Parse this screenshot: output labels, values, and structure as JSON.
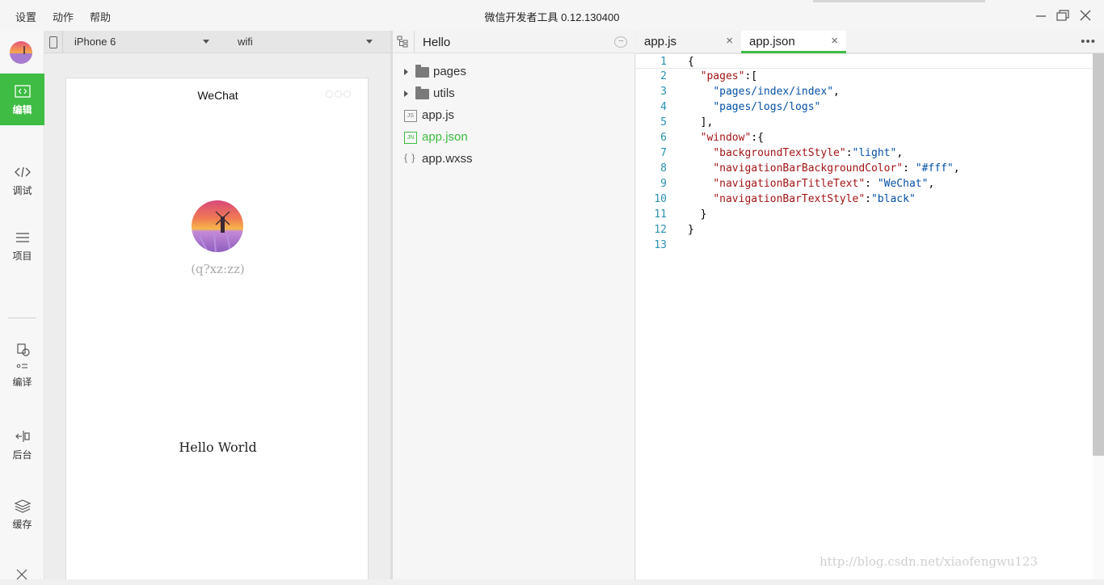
{
  "titlebar": {
    "menu": [
      "设置",
      "动作",
      "帮助"
    ],
    "title": "微信开发者工具 0.12.130400"
  },
  "leftnav": {
    "items": [
      {
        "label": "编辑",
        "icon": "code-icon",
        "active": true
      },
      {
        "label": "调试",
        "icon": "debug-icon"
      },
      {
        "label": "项目",
        "icon": "menu-icon"
      },
      {
        "label": "编译",
        "icon": "compile-icon"
      },
      {
        "label": "后台",
        "icon": "background-icon"
      },
      {
        "label": "缓存",
        "icon": "layers-icon"
      }
    ]
  },
  "simulator": {
    "device": "iPhone 6",
    "network": "wifi",
    "nav_title": "WeChat",
    "nickname": "(q?xz:zz)",
    "motto": "Hello World"
  },
  "tree": {
    "project": "Hello",
    "folders": [
      "pages",
      "utils"
    ],
    "files": [
      {
        "name": "app.js",
        "icon": "JS"
      },
      {
        "name": "app.json",
        "icon": "JN",
        "active": true
      },
      {
        "name": "app.wxss",
        "icon": "{ }"
      }
    ]
  },
  "editor": {
    "tabs": [
      {
        "label": "app.js",
        "close": "×"
      },
      {
        "label": "app.json",
        "close": "×",
        "active": true
      }
    ],
    "lines": [
      "{",
      "  \"pages\":[",
      "    \"pages/index/index\",",
      "    \"pages/logs/logs\"",
      "  ],",
      "  \"window\":{",
      "    \"backgroundTextStyle\":\"light\",",
      "    \"navigationBarBackgroundColor\": \"#fff\",",
      "    \"navigationBarTitleText\": \"WeChat\",",
      "    \"navigationBarTextStyle\":\"black\"",
      "  }",
      "}",
      ""
    ]
  },
  "watermark": "http://blog.csdn.net/xiaofengwu123",
  "colors": {
    "accent": "#3ebc43",
    "line_number": "#2b91af",
    "key": "#a31515",
    "string": "#0451a5"
  }
}
